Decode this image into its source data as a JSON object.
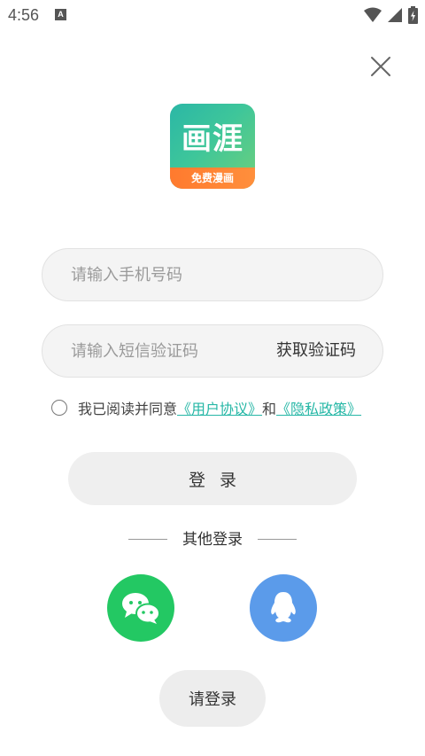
{
  "status_bar": {
    "time": "4:56",
    "notification_letter": "A"
  },
  "logo": {
    "title": "画涯",
    "banner": "免费漫画"
  },
  "phone_input": {
    "placeholder": "请输入手机号码",
    "value": ""
  },
  "code_input": {
    "placeholder": "请输入短信验证码",
    "value": ""
  },
  "get_code_label": "获取验证码",
  "agreement": {
    "prefix": "我已阅读并同意",
    "user_agreement": "《用户协议》",
    "conjunction": "和",
    "privacy_policy": "《隐私政策》"
  },
  "login_button_label": "登录",
  "other_login_label": "其他登录",
  "social": {
    "wechat_icon": "wechat-icon",
    "qq_icon": "qq-icon"
  },
  "please_login_label": "请登录",
  "colors": {
    "accent_link": "#26b7a6",
    "wechat": "#23c863",
    "qq": "#5b9bea",
    "logo_banner": "#ff7a2e"
  }
}
